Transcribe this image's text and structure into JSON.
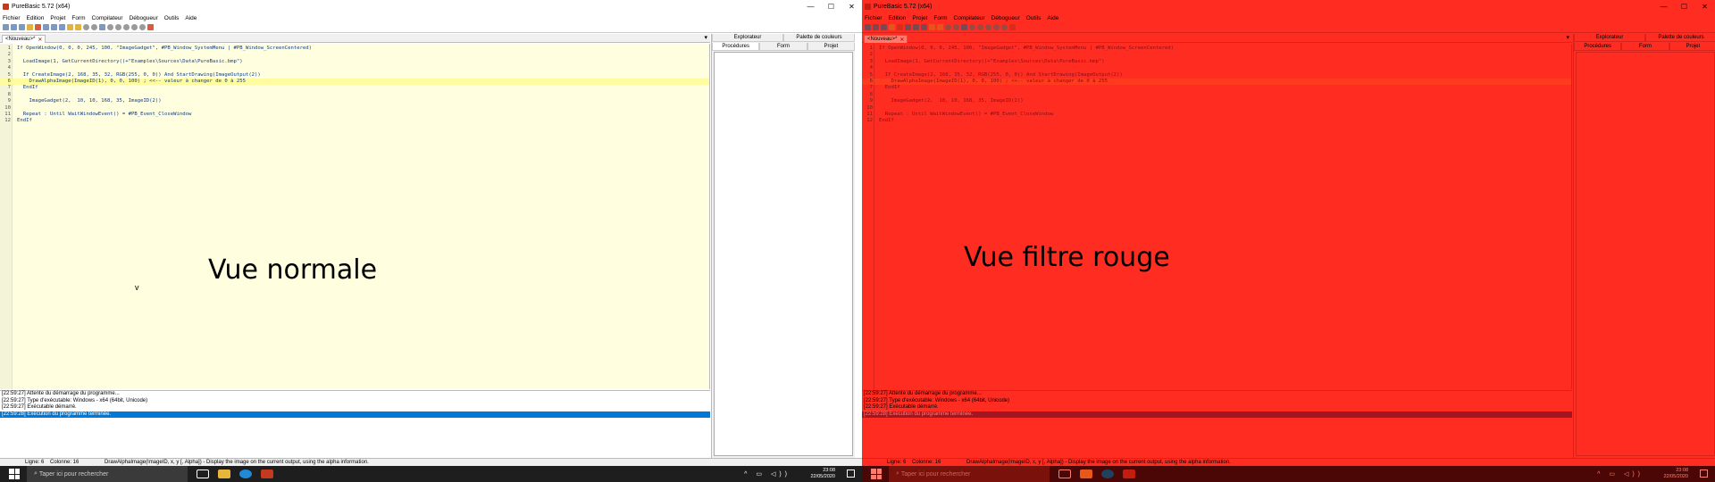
{
  "window": {
    "title": "PureBasic 5.72 (x64)",
    "controls": [
      "—",
      "☐",
      "✕"
    ]
  },
  "menu": [
    "Fichier",
    "Edition",
    "Projet",
    "Form",
    "Compilateur",
    "Débogueur",
    "Outils",
    "Aide"
  ],
  "tab": {
    "label": "<Nouveau>*",
    "close": "✕"
  },
  "code": [
    {
      "n": "1",
      "t": "If OpenWindow(0, 0, 0, 245, 100, \"ImageGadget\", #PB_Window_SystemMenu | #PB_Window_ScreenCentered)"
    },
    {
      "n": "2",
      "t": ""
    },
    {
      "n": "3",
      "t": "  LoadImage(1, GetCurrentDirectory()+\"Examples\\Sources\\Data\\PureBasic.bmp\")"
    },
    {
      "n": "4",
      "t": ""
    },
    {
      "n": "5",
      "t": "  If CreateImage(2, 168, 35, 32, RGB(255, 0, 0)) And StartDrawing(ImageOutput(2))"
    },
    {
      "n": "6",
      "t": "    DrawAlphaImage(ImageID(1), 0, 0, 100) ; <<-- valeur à changer de 0 à 255"
    },
    {
      "n": "7",
      "t": "  EndIf"
    },
    {
      "n": "8",
      "t": ""
    },
    {
      "n": "9",
      "t": "    ImageGadget(2,  10, 10, 168, 35, ImageID(2))"
    },
    {
      "n": "10",
      "t": ""
    },
    {
      "n": "11",
      "t": "  Repeat : Until WaitWindowEvent() = #PB_Event_CloseWindow"
    },
    {
      "n": "12",
      "t": "EndIf"
    }
  ],
  "labels": {
    "left": "Vue normale",
    "right": "Vue filtre rouge",
    "cursor_mark": "v"
  },
  "side_tabs_top": [
    "Explorateur",
    "Palette de couleurs"
  ],
  "side_tabs_bottom": [
    "Procédures",
    "Form",
    "Projet"
  ],
  "output": [
    "[22:59:27] Attente du démarrage du programme...",
    "[22:59:27] Type d'exécutable: Windows - x64 (64bit, Unicode)",
    "[22:59:27] Exécutable démarré.",
    "[22:59:28] Exécution du programme terminée."
  ],
  "status": {
    "line": "Ligne: 6",
    "column": "Colonne: 16",
    "hint": "DrawAlphaImage(ImageID, x, y [, Alpha]) - Display the image on the current output, using the alpha information."
  },
  "taskbar": {
    "search_placeholder": "Taper ici pour rechercher",
    "time": "23:08",
    "date": "22/05/2020",
    "tray_icons": "^ ▭ ◁))"
  },
  "colors": {
    "editor_bg": "#ffffdf",
    "selection": "#0078d7",
    "red_filter": "#ff2a12"
  }
}
